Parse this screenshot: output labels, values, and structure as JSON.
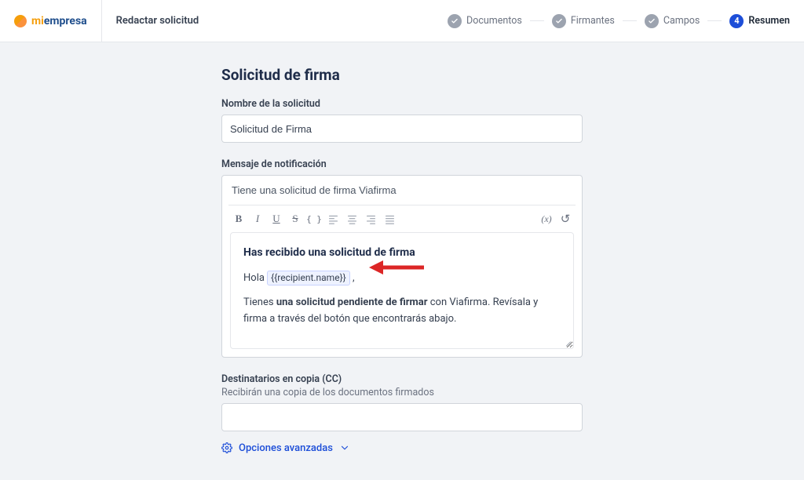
{
  "brand": {
    "accent": "#f59e0b",
    "logo_mi": "mi",
    "logo_rest": "empresa"
  },
  "header": {
    "page_title": "Redactar solicitud",
    "steps": [
      {
        "label": "Documentos",
        "state": "done"
      },
      {
        "label": "Firmantes",
        "state": "done"
      },
      {
        "label": "Campos",
        "state": "done"
      },
      {
        "label": "Resumen",
        "state": "active",
        "number": "4"
      }
    ]
  },
  "form": {
    "heading": "Solicitud de firma",
    "name_label": "Nombre de la solicitud",
    "name_value": "Solicitud de Firma",
    "message_label": "Mensaje de notificación",
    "subject_value": "Tiene una solicitud de firma Viafirma",
    "body_heading": "Has recibido una solicitud de firma",
    "body_hello": "Hola",
    "body_token": "{{recipient.name}}",
    "body_comma": ",",
    "body_line2_a": "Tienes ",
    "body_line2_b": "una solicitud pendiente de firmar",
    "body_line2_c": " con Viafirma. Revísala y firma a través del botón que encontrarás abajo.",
    "cc_label": "Destinatarios en copia (CC)",
    "cc_sublabel": "Recibirán una copia de los documentos firmados",
    "cc_value": "",
    "advanced_label": "Opciones avanzadas"
  },
  "toolbar": {
    "bold": "B",
    "italic": "I",
    "underline": "U",
    "strike": "S",
    "code": "{ }",
    "align_left": "≡",
    "align_center": "≡",
    "align_right": "≡",
    "align_justify": "≡",
    "variable": "(x)",
    "undo": "↺"
  },
  "annotation": {
    "arrow_color": "#dc2626"
  }
}
